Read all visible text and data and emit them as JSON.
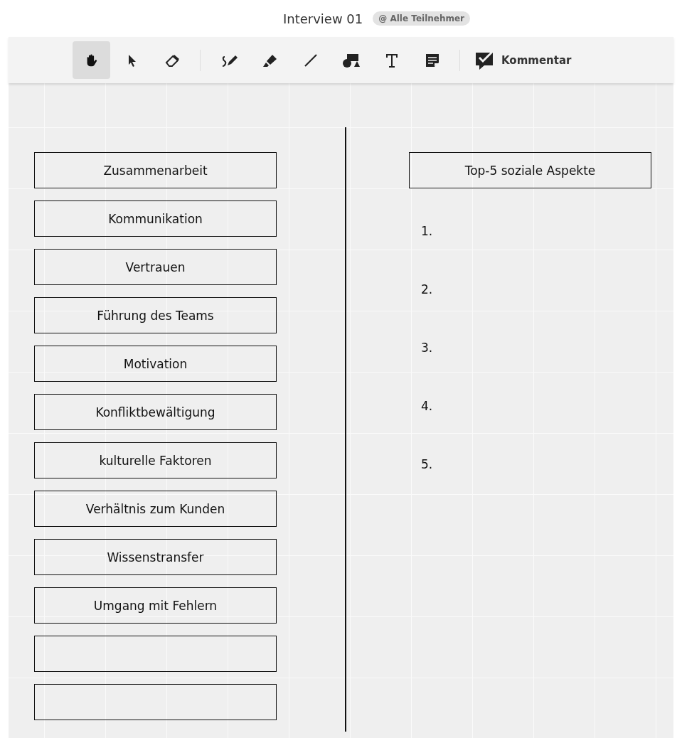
{
  "header": {
    "title": "Interview 01",
    "audience": "@ Alle Teilnehmer"
  },
  "toolbar": {
    "tools": [
      {
        "kind": "hand",
        "selected": true
      },
      {
        "kind": "pointer",
        "selected": false
      },
      {
        "kind": "eraser",
        "selected": false
      },
      {
        "kind": "separator"
      },
      {
        "kind": "pen",
        "selected": false
      },
      {
        "kind": "highlighter",
        "selected": false
      },
      {
        "kind": "line",
        "selected": false
      },
      {
        "kind": "shapes",
        "selected": false
      },
      {
        "kind": "text",
        "selected": false
      },
      {
        "kind": "note",
        "selected": false
      },
      {
        "kind": "separator"
      }
    ],
    "comment": {
      "label": "Kommentar"
    }
  },
  "board": {
    "cards": [
      {
        "kind": "text",
        "label": "Zusammenarbeit"
      },
      {
        "kind": "text",
        "label": "Kommunikation"
      },
      {
        "kind": "text",
        "label": "Vertrauen"
      },
      {
        "kind": "text",
        "label": "Führung des Teams"
      },
      {
        "kind": "text",
        "label": "Motivation"
      },
      {
        "kind": "text",
        "label": "Konfliktbewältigung"
      },
      {
        "kind": "text",
        "label": "kulturelle Faktoren"
      },
      {
        "kind": "text",
        "label": "Verhältnis zum Kunden"
      },
      {
        "kind": "text",
        "label": "Wissenstransfer"
      },
      {
        "kind": "text",
        "label": "Umgang mit Fehlern"
      },
      {
        "kind": "blank"
      },
      {
        "kind": "blank"
      }
    ],
    "ranking": {
      "title": "Top-5 soziale Aspekte",
      "slots": [
        "1.",
        "2.",
        "3.",
        "4.",
        "5."
      ]
    }
  }
}
